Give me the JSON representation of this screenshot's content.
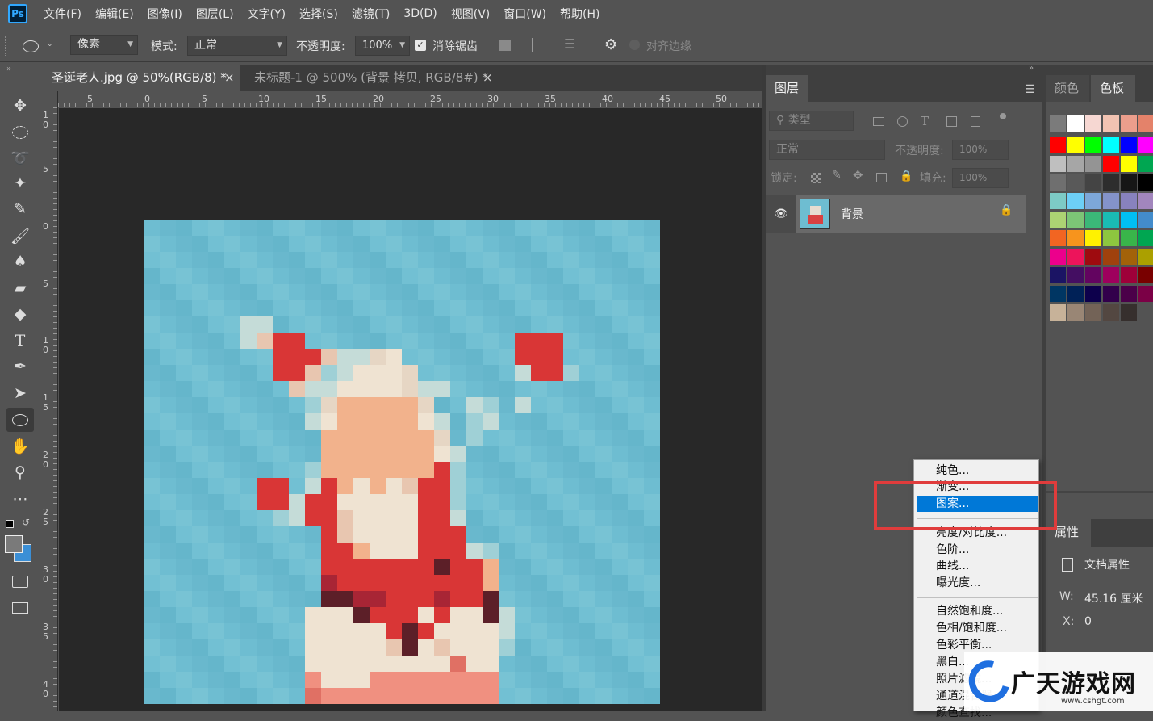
{
  "app": {
    "logo": "Ps"
  },
  "menubar": {
    "items": [
      "文件(F)",
      "编辑(E)",
      "图像(I)",
      "图层(L)",
      "文字(Y)",
      "选择(S)",
      "滤镜(T)",
      "3D(D)",
      "视图(V)",
      "窗口(W)",
      "帮助(H)"
    ]
  },
  "options": {
    "shape_mode": "像素",
    "mode_label": "模式:",
    "mode_value": "正常",
    "opacity_label": "不透明度:",
    "opacity_value": "100%",
    "antialias_label": "消除锯齿",
    "align_edges_label": "对齐边缘"
  },
  "tabs": [
    {
      "label": "圣诞老人.jpg @ 50%(RGB/8) *",
      "close": "×",
      "active": true
    },
    {
      "label": "未标题-1 @ 500% (背景 拷贝, RGB/8#) *",
      "close": "×",
      "active": false
    }
  ],
  "ruler": {
    "top": [
      "5",
      "0",
      "5",
      "10",
      "15",
      "20",
      "25",
      "30",
      "35",
      "40",
      "45",
      "50"
    ],
    "left": [
      "1\n0",
      "5",
      "0",
      "5",
      "1\n0",
      "1\n5",
      "2\n0",
      "2\n5",
      "3\n0",
      "3\n5",
      "4\n0"
    ]
  },
  "layers_panel": {
    "tab": "图层",
    "filter_placeholder": "类型",
    "blend_mode": "正常",
    "opacity_label": "不透明度:",
    "opacity_value": "100%",
    "lock_label": "锁定:",
    "fill_label": "填充:",
    "fill_value": "100%",
    "layer_name": "背景"
  },
  "swatch_panel": {
    "tabs": [
      "颜色",
      "色板"
    ],
    "active_tab": "色板",
    "swatches": [
      [
        "#7b7b7b",
        "#ffffff",
        "#f6d7d2",
        "#f2c3b2",
        "#ec9e8c",
        "#e4826a"
      ],
      [
        "#ff0000",
        "#ffff00",
        "#00ff00",
        "#00ffff",
        "#0000ff",
        "#ff00ff"
      ],
      [
        "#bfbfbf",
        "#a6a6a6",
        "#949494",
        "#ff0000",
        "#ffff00",
        "#00a651"
      ],
      [
        "#6f6f6f",
        "#595959",
        "#444444",
        "#2d2d2d",
        "#161616",
        "#000000"
      ],
      [
        "#7dcbc6",
        "#6dcff6",
        "#7da7d9",
        "#8493ca",
        "#8882be",
        "#a286bd"
      ],
      [
        "#acd373",
        "#7cc576",
        "#3bb878",
        "#1abbb4",
        "#00bff3",
        "#438ccb"
      ],
      [
        "#f26522",
        "#f7941d",
        "#fff200",
        "#8dc63f",
        "#39b54a",
        "#00a651"
      ],
      [
        "#ec008c",
        "#ed145b",
        "#9e0b0f",
        "#a0410d",
        "#a36209",
        "#aba000"
      ],
      [
        "#1b1464",
        "#440e62",
        "#630460",
        "#9e005d",
        "#9e0039",
        "#790000"
      ],
      [
        "#003663",
        "#002157",
        "#0d004c",
        "#32004b",
        "#4b0049",
        "#7b0046"
      ],
      [
        "#c7b299",
        "#998675",
        "#736357",
        "#534741",
        "#362f2d",
        ""
      ]
    ]
  },
  "props_panel": {
    "tab": "属性",
    "doc_props": "文档属性",
    "w_label": "W:",
    "w_value": "45.16 厘米",
    "x_label": "X:",
    "x_value": "0"
  },
  "context_menu": {
    "items": [
      {
        "label": "纯色...",
        "group": 1
      },
      {
        "label": "渐变...",
        "group": 1
      },
      {
        "label": "图案...",
        "group": 1,
        "selected": true
      },
      {
        "label": "亮度/对比度...",
        "group": 2
      },
      {
        "label": "色阶...",
        "group": 2
      },
      {
        "label": "曲线...",
        "group": 2
      },
      {
        "label": "曝光度...",
        "group": 2
      },
      {
        "label": "自然饱和度...",
        "group": 3
      },
      {
        "label": "色相/饱和度...",
        "group": 3
      },
      {
        "label": "色彩平衡...",
        "group": 3
      },
      {
        "label": "黑白...",
        "group": 3
      },
      {
        "label": "照片滤镜...",
        "group": 3
      },
      {
        "label": "通道混合器...",
        "group": 3
      },
      {
        "label": "颜色查找...",
        "group": 3
      }
    ],
    "highlight_color": "#0078d7"
  },
  "watermark": {
    "name": "广天游戏网",
    "url": "www.cshgt.com"
  },
  "colors": {
    "canvas_bg": "#282828",
    "doc_bg": "#6ebdd1",
    "annotation": "#e03c3c"
  }
}
